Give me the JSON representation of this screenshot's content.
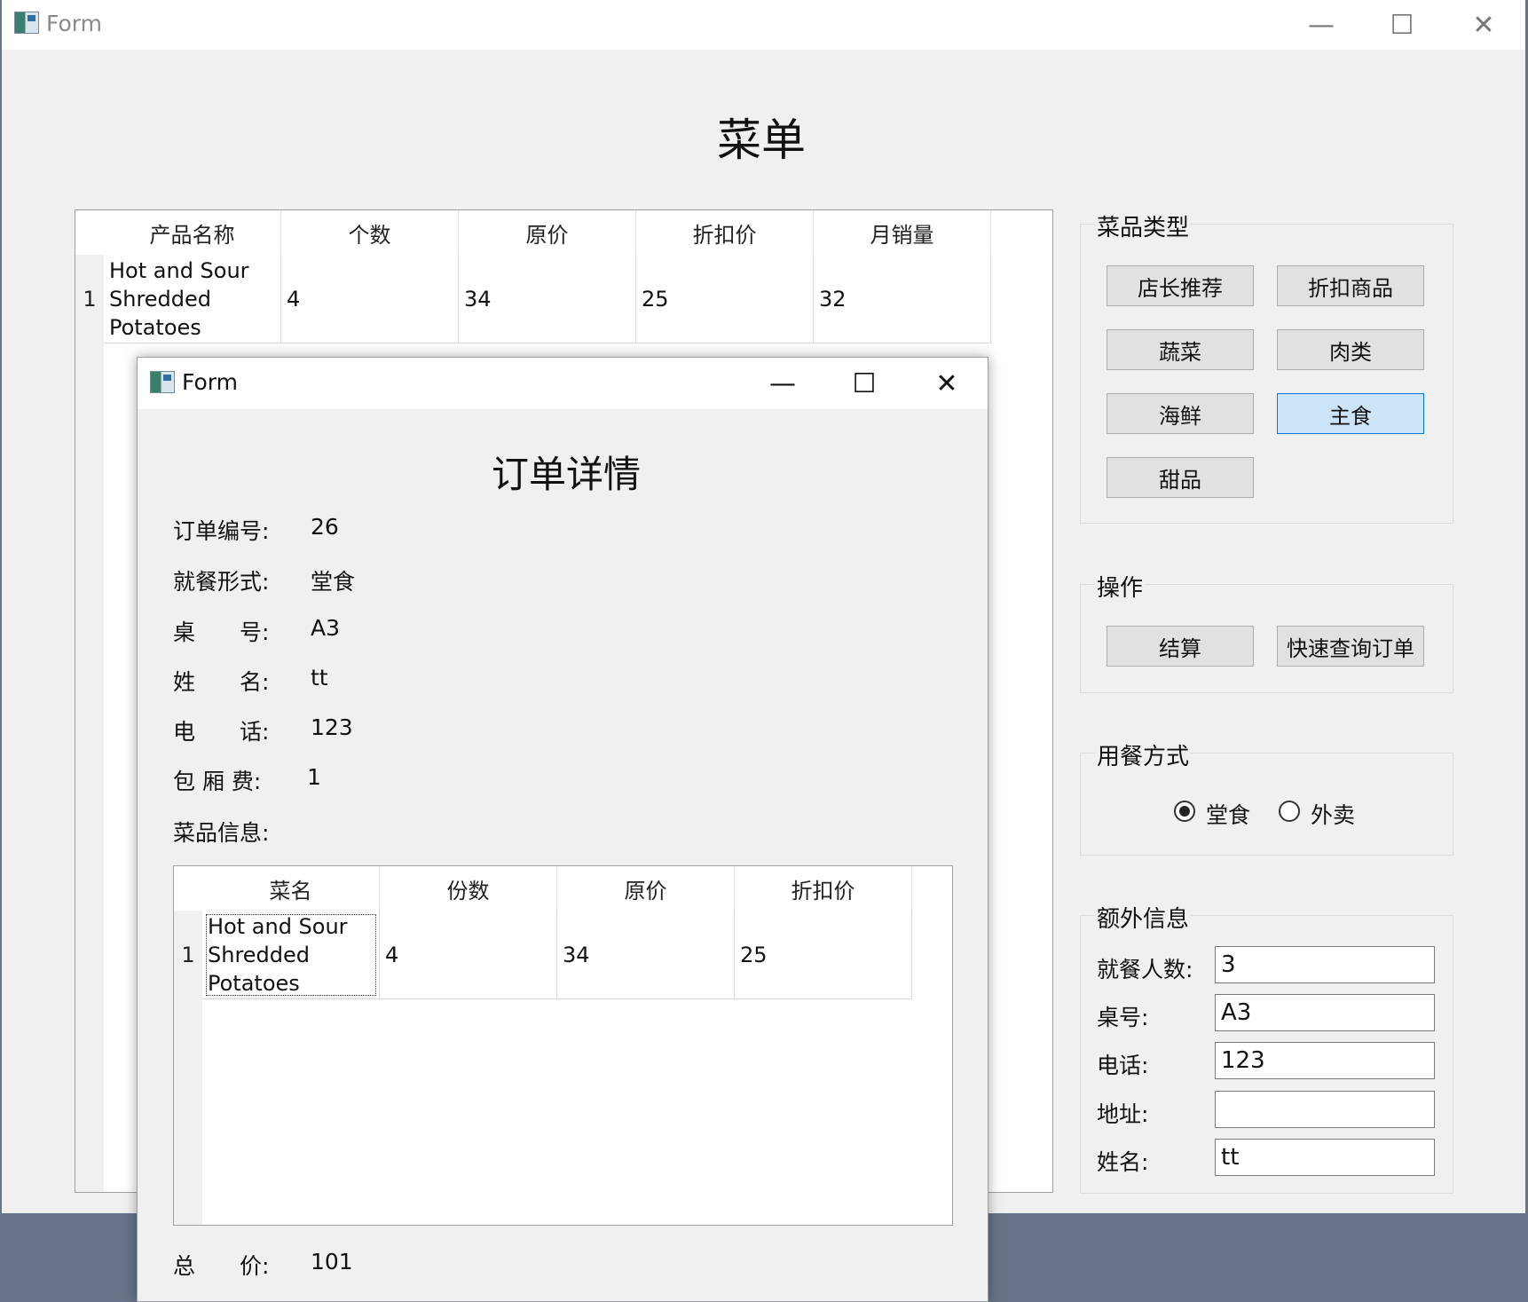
{
  "main_window": {
    "title": "Form",
    "controls": {
      "minimize": "—",
      "maximize": "☐",
      "close": "✕"
    },
    "heading": "菜单",
    "product_table": {
      "columns": [
        "产品名称",
        "个数",
        "原价",
        "折扣价",
        "月销量"
      ],
      "rows": [
        {
          "num": "1",
          "name": "Hot and Sour Shredded Potatoes",
          "count": "4",
          "price": "34",
          "discount": "25",
          "monthly_sales": "32"
        }
      ]
    },
    "category_group": {
      "label": "菜品类型",
      "buttons": [
        "店长推荐",
        "折扣商品",
        "蔬菜",
        "肉类",
        "海鲜",
        "主食",
        "甜品"
      ],
      "selected": "主食"
    },
    "operation_group": {
      "label": "操作",
      "buttons": [
        "结算",
        "快速查询订单"
      ]
    },
    "dining_group": {
      "label": "用餐方式",
      "options": [
        "堂食",
        "外卖"
      ],
      "selected": "堂食"
    },
    "extra_group": {
      "label": "额外信息",
      "fields": [
        {
          "label": "就餐人数:",
          "value": "3"
        },
        {
          "label": "桌号:",
          "value": "A3"
        },
        {
          "label": "电话:",
          "value": "123"
        },
        {
          "label": "地址:",
          "value": ""
        },
        {
          "label": "姓名:",
          "value": "tt"
        }
      ]
    }
  },
  "order_dialog": {
    "title": "Form",
    "controls": {
      "minimize": "—",
      "maximize": "☐",
      "close": "✕"
    },
    "heading": "订单详情",
    "info": [
      {
        "label": "订单编号:",
        "value": "26"
      },
      {
        "label": "就餐形式:",
        "value": "堂食"
      },
      {
        "label": "桌　　号:",
        "value": "A3"
      },
      {
        "label": "姓　　名:",
        "value": "tt"
      },
      {
        "label": "电　　话:",
        "value": "123"
      },
      {
        "label": "包 厢 费:",
        "value": "1"
      }
    ],
    "dish_info_label": "菜品信息:",
    "dish_table": {
      "columns": [
        "菜名",
        "份数",
        "原价",
        "折扣价"
      ],
      "rows": [
        {
          "num": "1",
          "name": "Hot and Sour Shredded Potatoes",
          "count": "4",
          "price": "34",
          "discount": "25"
        }
      ]
    },
    "total_label": "总　　价:",
    "total_value": "101"
  }
}
